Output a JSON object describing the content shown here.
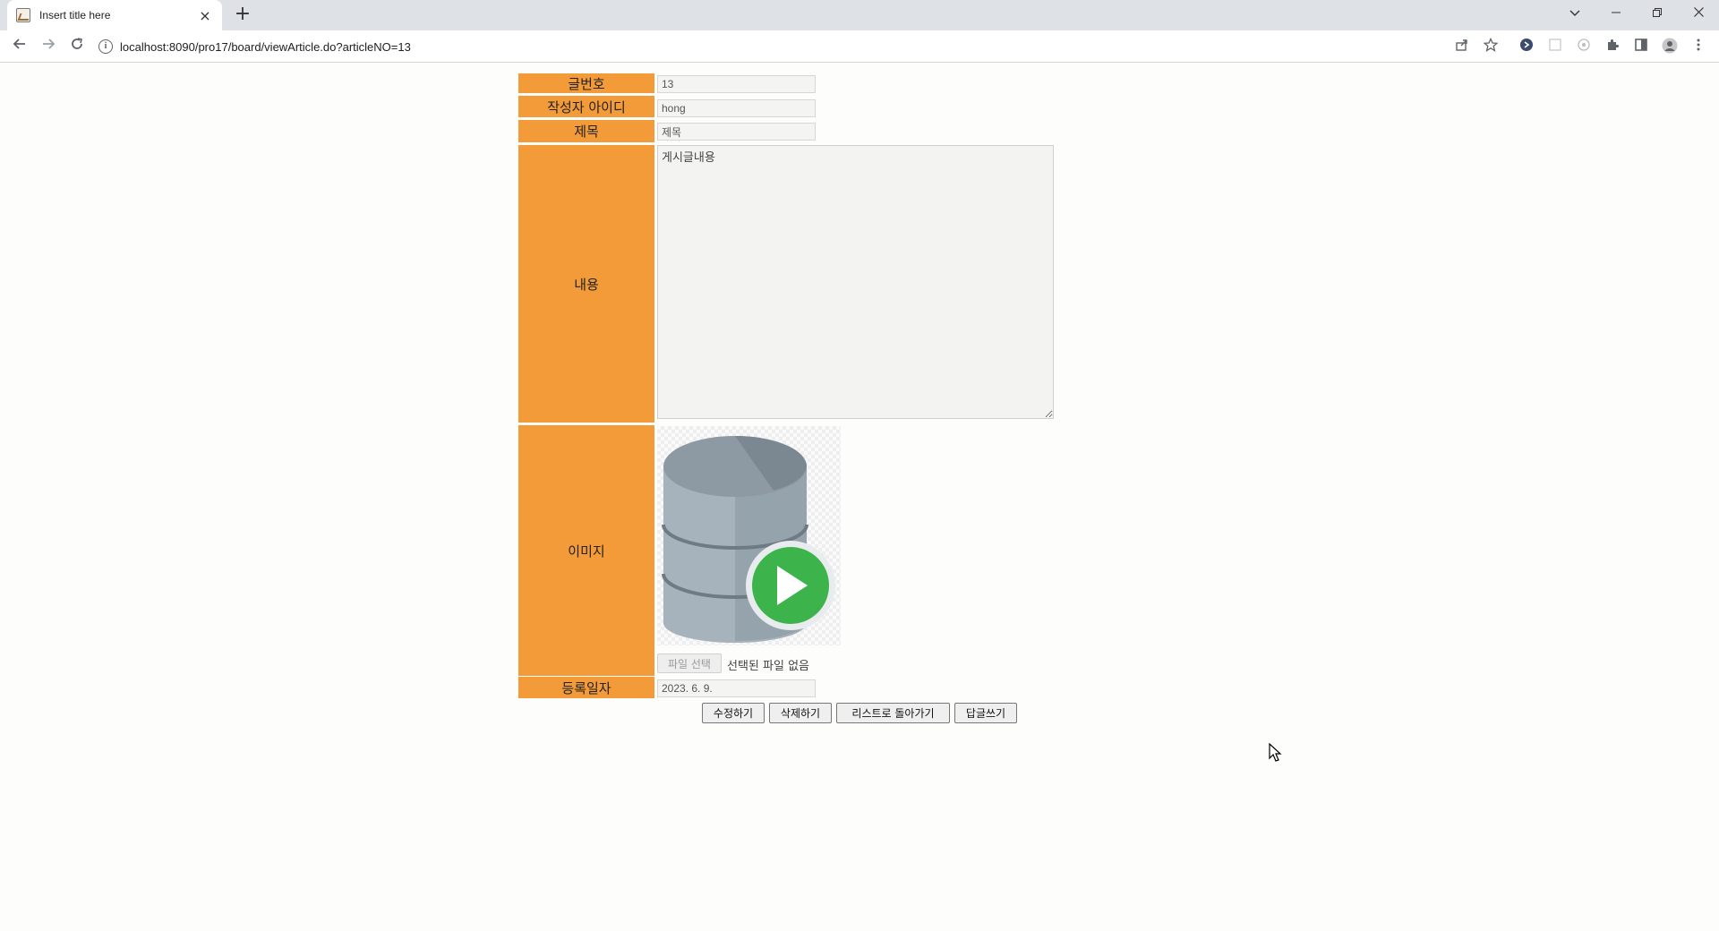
{
  "browser": {
    "tab_title": "Insert title here",
    "tab_close": "×",
    "new_tab": "+",
    "url_host": "localhost",
    "url_path": ":8090/pro17/board/viewArticle.do?articleNO=13"
  },
  "form": {
    "article_no_label": "글번호",
    "article_no_value": "13",
    "writer_label": "작성자 아이디",
    "writer_value": "hong",
    "title_label": "제목",
    "title_value": "제목",
    "content_label": "내용",
    "content_value": "게시글내용",
    "image_label": "이미지",
    "file_button": "파일 선택",
    "file_status": "선택된 파일 없음",
    "date_label": "등록일자",
    "date_value": "2023. 6. 9."
  },
  "buttons": {
    "edit": "수정하기",
    "delete": "삭제하기",
    "back_to_list": "리스트로 돌아가기",
    "reply": "답글쓰기"
  },
  "colors": {
    "label_bg": "#f29b38",
    "db_icon": "#a6b3bc",
    "play_green": "#3cb44b"
  },
  "icons": [
    "database-icon",
    "play-icon",
    "info-icon",
    "star-icon",
    "puzzle-icon",
    "profile-icon"
  ]
}
